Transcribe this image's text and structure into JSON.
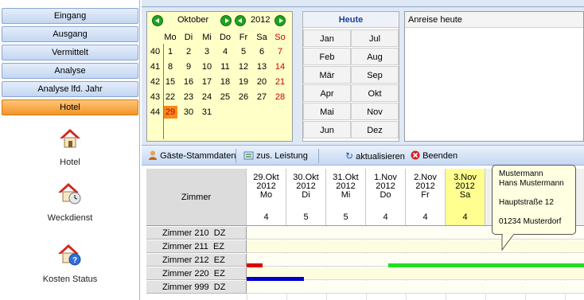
{
  "nav": {
    "items": [
      {
        "label": "Eingang",
        "active": false
      },
      {
        "label": "Ausgang",
        "active": false
      },
      {
        "label": "Vermittelt",
        "active": false
      },
      {
        "label": "Analyse",
        "active": false
      },
      {
        "label": "Analyse lfd. Jahr",
        "active": false
      },
      {
        "label": "Hotel",
        "active": true
      }
    ]
  },
  "tiles": [
    {
      "label": "Hotel",
      "icon": "house-icon"
    },
    {
      "label": "Weckdienst",
      "icon": "house-clock-icon"
    },
    {
      "label": "Kosten Status",
      "icon": "house-help-icon"
    }
  ],
  "calendar": {
    "month": "Oktober",
    "year": "2012",
    "weekdays": [
      "Mo",
      "Di",
      "Mi",
      "Do",
      "Fr",
      "Sa",
      "So"
    ],
    "weeks": [
      {
        "num": "40",
        "days": [
          "1",
          "2",
          "3",
          "4",
          "5",
          "6",
          "7"
        ]
      },
      {
        "num": "41",
        "days": [
          "8",
          "9",
          "10",
          "11",
          "12",
          "13",
          "14"
        ]
      },
      {
        "num": "42",
        "days": [
          "15",
          "16",
          "17",
          "18",
          "19",
          "20",
          "21"
        ]
      },
      {
        "num": "43",
        "days": [
          "22",
          "23",
          "24",
          "25",
          "26",
          "27",
          "28"
        ]
      },
      {
        "num": "44",
        "days": [
          "29",
          "30",
          "31",
          "",
          "",
          "",
          ""
        ]
      }
    ],
    "selected_day": "29"
  },
  "months": {
    "today_label": "Heute",
    "list": [
      "Jan",
      "Jul",
      "Feb",
      "Aug",
      "Mär",
      "Sep",
      "Apr",
      "Okt",
      "Mai",
      "Nov",
      "Jun",
      "Dez"
    ]
  },
  "arrival": {
    "header": "Anreise heute"
  },
  "toolbar": {
    "guests_label": "Gäste-Stammdaten",
    "extra_label": "zus. Leistung",
    "refresh_label": "aktualisieren",
    "exit_label": "Beenden"
  },
  "grid": {
    "room_header": "Zimmer",
    "columns": [
      {
        "date": "29.Okt",
        "year": "2012",
        "dow": "Mo",
        "count": "4"
      },
      {
        "date": "30.Okt",
        "year": "2012",
        "dow": "Di",
        "count": "5"
      },
      {
        "date": "31.Okt",
        "year": "2012",
        "dow": "Mi",
        "count": "5"
      },
      {
        "date": "1.Nov",
        "year": "2012",
        "dow": "Do",
        "count": "4"
      },
      {
        "date": "2.Nov",
        "year": "2012",
        "dow": "Fr",
        "count": "4"
      },
      {
        "date": "3.Nov",
        "year": "2012",
        "dow": "Sa",
        "count": "4"
      }
    ],
    "rows": [
      "Zimmer 210  DZ",
      "Zimmer 211  EZ",
      "Zimmer 212  EZ",
      "Zimmer 220  EZ",
      "Zimmer 999  DZ"
    ],
    "colors": {
      "red_bar": "#e00000",
      "green_bar": "#22dd22",
      "blue_bar": "#0000cc",
      "highlight": "#ffff90"
    }
  },
  "tooltip": {
    "line1": "Mustermann",
    "line2": "Hans Mustermann",
    "line3": "Hauptstraße 12",
    "line4": "01234 Musterdorf"
  }
}
